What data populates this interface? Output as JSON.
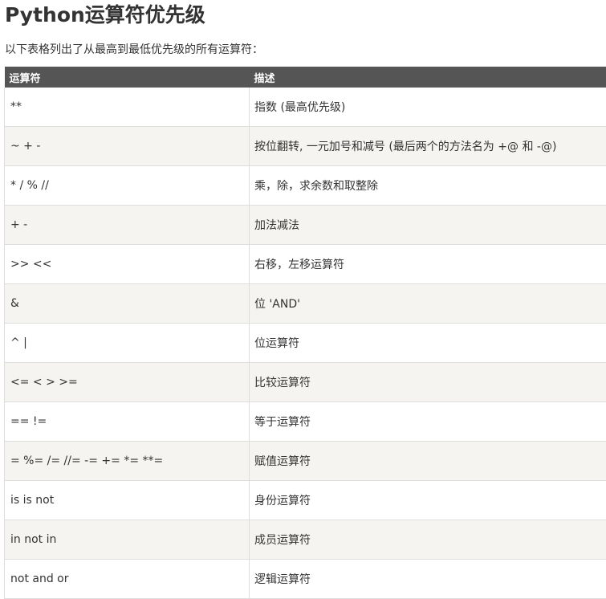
{
  "title": "Python运算符优先级",
  "intro": "以下表格列出了从最高到最低优先级的所有运算符：",
  "table": {
    "headers": [
      "运算符",
      "描述"
    ],
    "rows": [
      {
        "op": "**",
        "desc": "指数 (最高优先级)"
      },
      {
        "op": "~ + -",
        "desc": "按位翻转, 一元加号和减号 (最后两个的方法名为 +@ 和 -@)"
      },
      {
        "op": "* / % //",
        "desc": "乘，除，求余数和取整除"
      },
      {
        "op": "+ -",
        "desc": "加法减法"
      },
      {
        "op": ">> <<",
        "desc": "右移，左移运算符"
      },
      {
        "op": "&",
        "desc": "位 'AND'"
      },
      {
        "op": "^ |",
        "desc": "位运算符"
      },
      {
        "op": "<= < > >=",
        "desc": "比较运算符"
      },
      {
        "op": "== !=",
        "desc": "等于运算符"
      },
      {
        "op": "= %= /= //= -= += *= **=",
        "desc": "赋值运算符"
      },
      {
        "op": "is is not",
        "desc": "身份运算符"
      },
      {
        "op": "in not in",
        "desc": "成员运算符"
      },
      {
        "op": "not and or",
        "desc": "逻辑运算符"
      }
    ]
  },
  "colors": {
    "header_bg": "#555555",
    "row_alt_bg": "#f5f4f0",
    "text": "#333333"
  }
}
